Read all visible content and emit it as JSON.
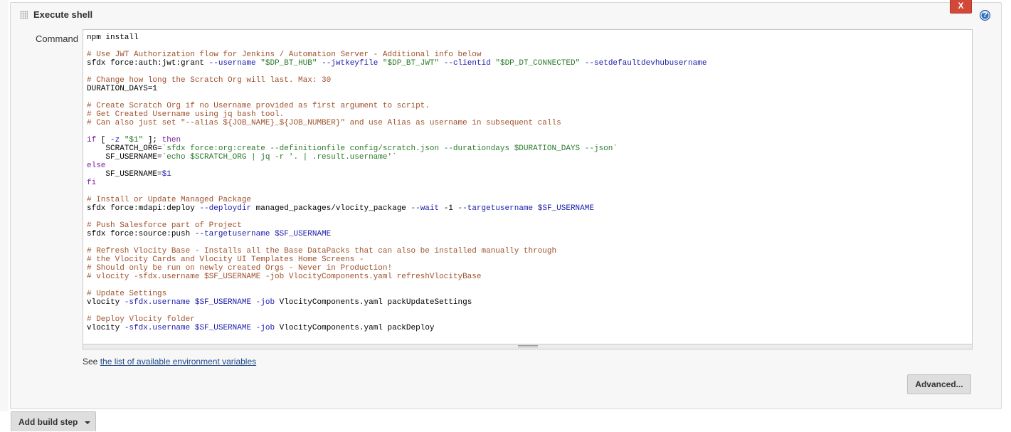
{
  "step": {
    "title": "Execute shell",
    "close_label": "X",
    "help_label": "?",
    "command_label": "Command"
  },
  "command_lines": [
    "npm install",
    "",
    "# Use JWT Authorization flow for Jenkins / Automation Server - Additional info below",
    "sfdx force:auth:jwt:grant --username \"$DP_BT_HUB\" --jwtkeyfile \"$DP_BT_JWT\" --clientid \"$DP_DT_CONNECTED\" --setdefaultdevhubusername",
    "",
    "# Change how long the Scratch Org will last. Max: 30",
    "DURATION_DAYS=1",
    "",
    "# Create Scratch Org if no Username provided as first argument to script.",
    "# Get Created Username using jq bash tool.",
    "# Can also just set \"--alias ${JOB_NAME}_${JOB_NUMBER}\" and use Alias as username in subsequent calls",
    "",
    "if [ -z \"$1\" ]; then",
    "    SCRATCH_ORG=`sfdx force:org:create --definitionfile config/scratch.json --durationdays $DURATION_DAYS --json`",
    "    SF_USERNAME=`echo $SCRATCH_ORG | jq -r '. | .result.username'`",
    "else",
    "    SF_USERNAME=$1",
    "fi",
    "",
    "# Install or Update Managed Package",
    "sfdx force:mdapi:deploy --deploydir managed_packages/vlocity_package --wait -1 --targetusername $SF_USERNAME",
    "",
    "# Push Salesforce part of Project",
    "sfdx force:source:push --targetusername $SF_USERNAME",
    "",
    "# Refresh Vlocity Base - Installs all the Base DataPacks that can also be installed manually through",
    "# the Vlocity Cards and Vlocity UI Templates Home Screens -",
    "# Should only be run on newly created Orgs - Never in Production!",
    "# vlocity -sfdx.username $SF_USERNAME -job VlocityComponents.yaml refreshVlocityBase",
    "",
    "# Update Settings",
    "vlocity -sfdx.username $SF_USERNAME -job VlocityComponents.yaml packUpdateSettings",
    "",
    "# Deploy Vlocity folder",
    "vlocity -sfdx.username $SF_USERNAME -job VlocityComponents.yaml packDeploy"
  ],
  "env_vars": {
    "prefix": "See ",
    "link_text": "the list of available environment variables"
  },
  "buttons": {
    "advanced": "Advanced...",
    "add_build_step": "Add build step"
  },
  "colors": {
    "close_button": "#d24939",
    "help_icon": "#2f72c1",
    "comment": "#a0522d",
    "option": "#1d1dab",
    "string": "#2a7a2a",
    "keyword": "#7a1e9e"
  }
}
